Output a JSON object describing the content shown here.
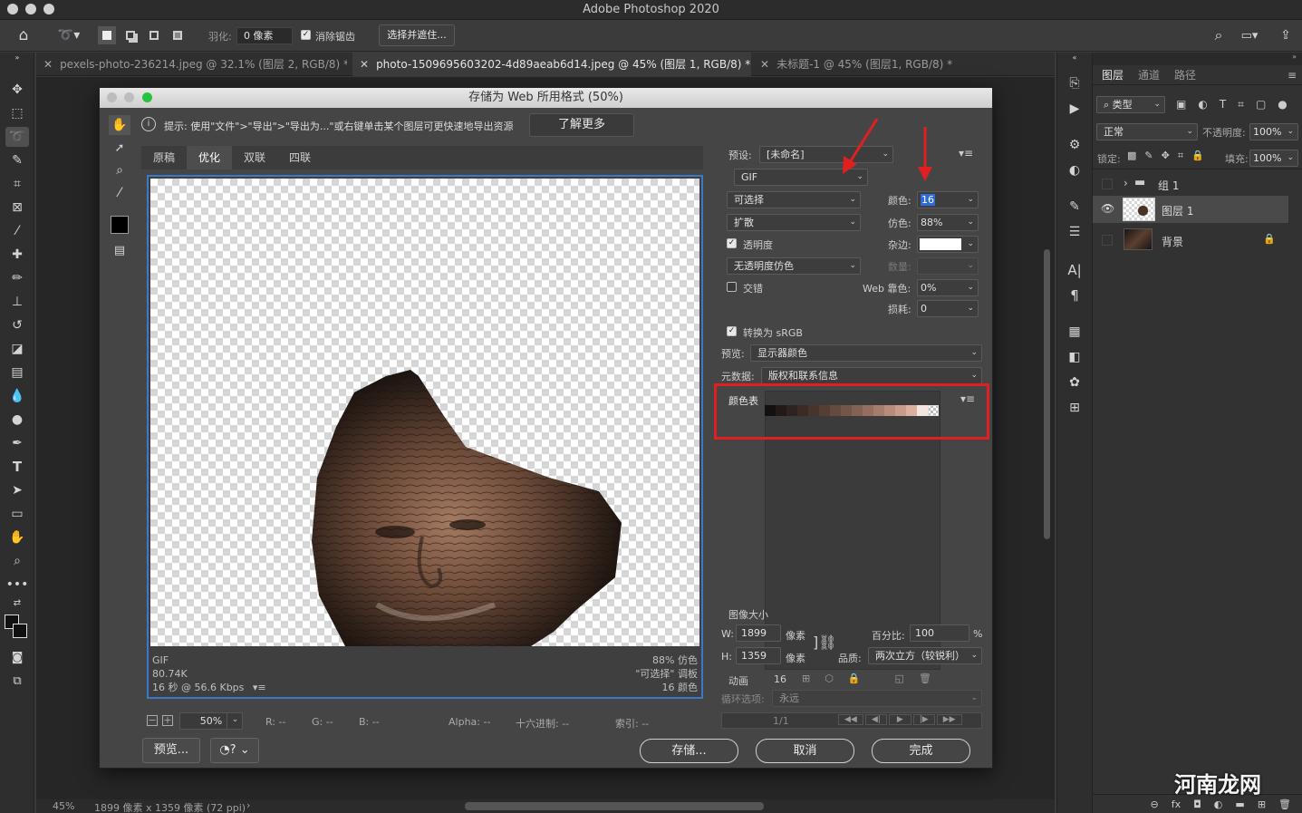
{
  "app": {
    "title": "Adobe Photoshop 2020"
  },
  "options_bar": {
    "feather_label": "羽化:",
    "feather_value": "0 像素",
    "antialias_label": "消除锯齿",
    "select_mask_button": "选择并遮住..."
  },
  "doc_tabs": [
    {
      "label": "pexels-photo-236214.jpeg @ 32.1% (图层 2, RGB/8) *"
    },
    {
      "label": "photo-1509695603202-4d89aeab6d14.jpeg @ 45% (图层 1, RGB/8) *"
    },
    {
      "label": "未标题-1 @ 45% (图层1, RGB/8) *"
    }
  ],
  "status_bar": {
    "zoom": "45%",
    "doc_info": "1899 像素 x 1359 像素 (72 ppi)"
  },
  "layers_panel": {
    "tabs": [
      "图层",
      "通道",
      "路径"
    ],
    "filter_kind": "类型",
    "blend_mode": "正常",
    "opacity_label": "不透明度:",
    "opacity_value": "100%",
    "lock_label": "锁定:",
    "fill_label": "填充:",
    "fill_value": "100%",
    "layers": [
      {
        "name": "组 1",
        "type": "group",
        "visible": false
      },
      {
        "name": "图层 1",
        "type": "layer",
        "visible": true
      },
      {
        "name": "背景",
        "type": "background",
        "visible": false
      }
    ]
  },
  "dialog": {
    "title": "存储为 Web 所用格式 (50%)",
    "tip": "提示: 使用\"文件\">\"导出\">\"导出为...\"或右键单击某个图层可更快速地导出资源",
    "learn_more": "了解更多",
    "view_tabs": [
      "原稿",
      "优化",
      "双联",
      "四联"
    ],
    "preview_info": {
      "format": "GIF",
      "size": "80.74K",
      "speed": "16 秒 @ 56.6 Kbps",
      "dither": "88% 仿色",
      "palette": "\"可选择\" 调板",
      "colors": "16 颜色"
    },
    "settings": {
      "preset_label": "预设:",
      "preset_value": "[未命名]",
      "format_value": "GIF",
      "reduction_value": "可选择",
      "colors_label": "颜色:",
      "colors_value": "16",
      "dither_algo_value": "扩散",
      "dither_label": "仿色:",
      "dither_value": "88%",
      "transparency_label": "透明度",
      "matte_label": "杂边:",
      "trans_dither_value": "无透明度仿色",
      "amount_label": "数量:",
      "interlaced_label": "交错",
      "web_snap_label": "Web 靠色:",
      "web_snap_value": "0%",
      "lossy_label": "损耗:",
      "lossy_value": "0",
      "convert_srgb_label": "转换为 sRGB",
      "preview_label": "预览:",
      "preview_value": "显示器颜色",
      "metadata_label": "元数据:",
      "metadata_value": "版权和联系信息"
    },
    "color_table": {
      "label": "颜色表",
      "count": "16",
      "swatches": [
        "#141010",
        "#221a16",
        "#2e231e",
        "#3a2c25",
        "#47352d",
        "#553f35",
        "#654a3e",
        "#745648",
        "#846253",
        "#946f5f",
        "#a57d6c",
        "#b78c7a",
        "#c89c8a",
        "#dbb09f",
        "#f2e6df",
        "transparent"
      ]
    },
    "image_size": {
      "label": "图像大小",
      "w_label": "W:",
      "w_value": "1899",
      "h_label": "H:",
      "h_value": "1359",
      "unit": "像素",
      "percent_label": "百分比:",
      "percent_value": "100",
      "percent_unit": "%",
      "quality_label": "品质:",
      "quality_value": "两次立方（较锐利）"
    },
    "animation": {
      "label": "动画",
      "loop_label": "循环选项:",
      "loop_value": "永远",
      "frame_counter": "1/1"
    },
    "bottom_info": {
      "zoom": "50%",
      "r": "R: --",
      "g": "G: --",
      "b": "B: --",
      "alpha": "Alpha: --",
      "hex": "十六进制: --",
      "index": "索引: --"
    },
    "buttons": {
      "preview": "预览...",
      "save": "存储...",
      "cancel": "取消",
      "done": "完成"
    }
  },
  "colors": {
    "accent_red": "#e02020",
    "selection_blue": "#2f6bd6",
    "preview_border": "#3a78c8"
  },
  "watermark": "河南龙网"
}
